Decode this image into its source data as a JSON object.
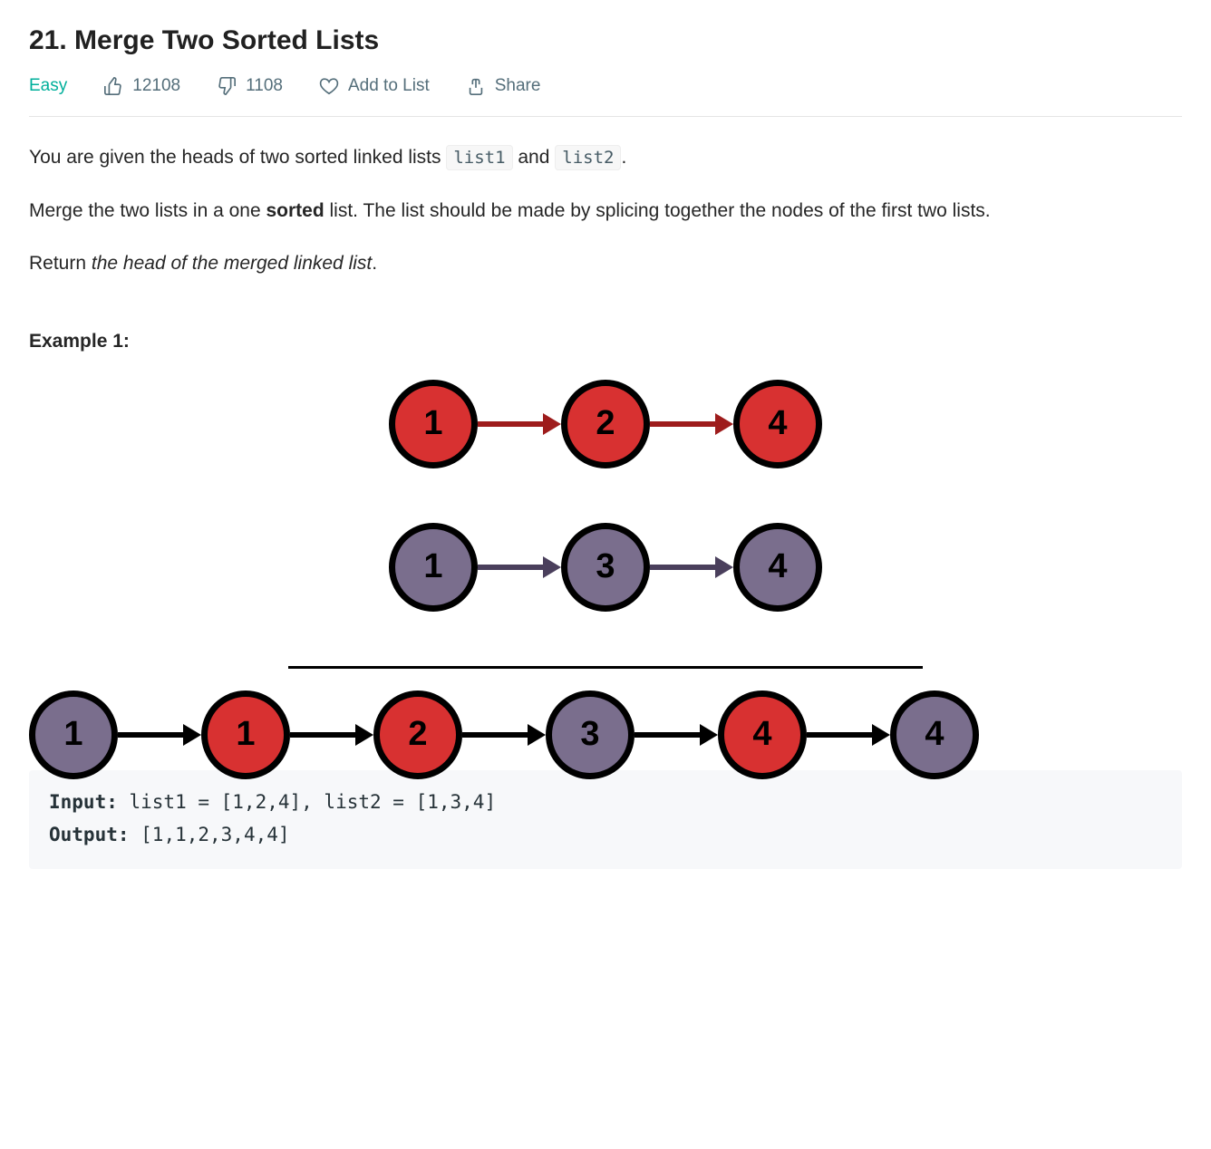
{
  "title": "21. Merge Two Sorted Lists",
  "meta": {
    "difficulty": "Easy",
    "likes": "12108",
    "dislikes": "1108",
    "addToList": "Add to List",
    "share": "Share"
  },
  "description": {
    "p1_prefix": "You are given the heads of two sorted linked lists ",
    "code_list1": "list1",
    "p1_mid": " and ",
    "code_list2": "list2",
    "p1_suffix": ".",
    "p2_prefix": "Merge the two lists in a one ",
    "p2_bold": "sorted",
    "p2_suffix": " list. The list should be made by splicing together the nodes of the first two lists.",
    "p3_prefix": "Return ",
    "p3_italic": "the head of the merged linked list",
    "p3_suffix": "."
  },
  "example": {
    "label": "Example 1:",
    "input_label": "Input:",
    "input_value": " list1 = [1,2,4], list2 = [1,3,4]",
    "output_label": "Output:",
    "output_value": " [1,1,2,3,4,4]"
  },
  "diagram": {
    "list1": [
      {
        "v": "1",
        "color": "red"
      },
      {
        "v": "2",
        "color": "red"
      },
      {
        "v": "4",
        "color": "red"
      }
    ],
    "list2": [
      {
        "v": "1",
        "color": "purple"
      },
      {
        "v": "3",
        "color": "purple"
      },
      {
        "v": "4",
        "color": "purple"
      }
    ],
    "merged": [
      {
        "v": "1",
        "color": "purple"
      },
      {
        "v": "1",
        "color": "red"
      },
      {
        "v": "2",
        "color": "red"
      },
      {
        "v": "3",
        "color": "purple"
      },
      {
        "v": "4",
        "color": "red"
      },
      {
        "v": "4",
        "color": "purple"
      }
    ]
  }
}
